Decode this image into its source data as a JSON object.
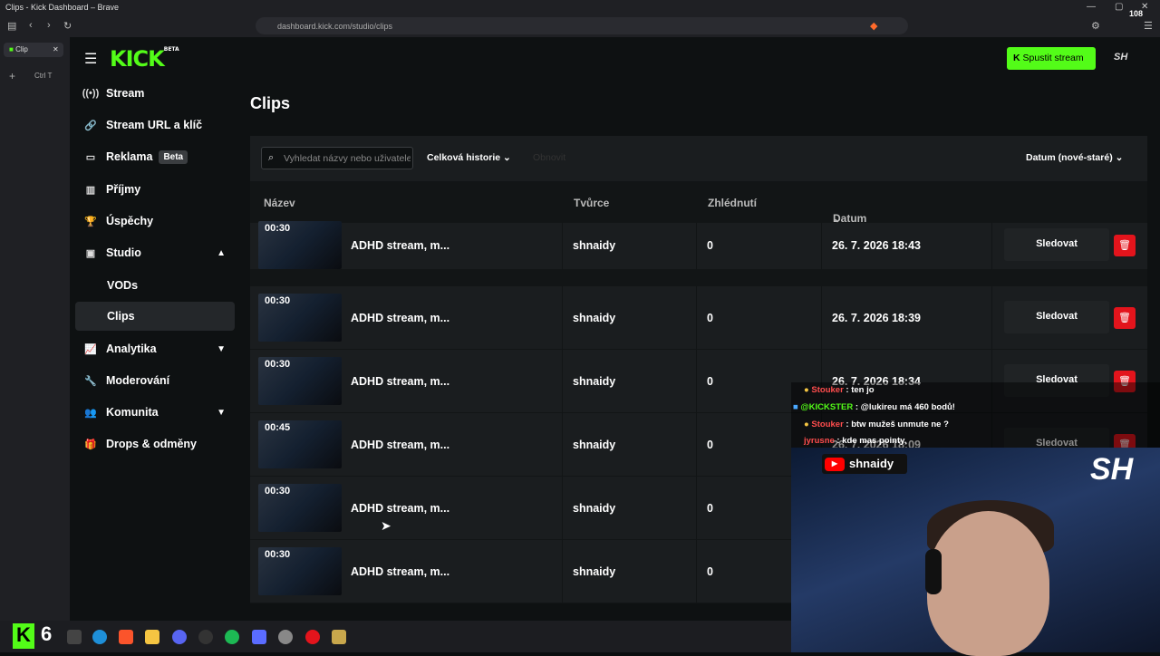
{
  "browser": {
    "window_title": "Clips - Kick Dashboard – Brave",
    "url": "dashboard.kick.com/studio/clips",
    "tab_label": "Clip",
    "tab_shortcut": "Ctrl T",
    "counter": "108"
  },
  "header": {
    "logo": "KICK",
    "logo_badge": "BETA",
    "go_live_label": "Spustit stream",
    "avatar_label": "SH"
  },
  "sidebar": {
    "items": [
      {
        "icon": "broadcast-icon",
        "label": "Stream"
      },
      {
        "icon": "link-icon",
        "label": "Stream URL a klíč"
      },
      {
        "icon": "ad-icon",
        "label": "Reklama",
        "badge": "Beta"
      },
      {
        "icon": "revenue-icon",
        "label": "Příjmy"
      },
      {
        "icon": "trophy-icon",
        "label": "Úspěchy"
      },
      {
        "icon": "studio-icon",
        "label": "Studio"
      },
      {
        "icon": "",
        "label": "VODs"
      },
      {
        "icon": "",
        "label": "Clips"
      },
      {
        "icon": "analytics-icon",
        "label": "Analytika"
      },
      {
        "icon": "wrench-icon",
        "label": "Moderování"
      },
      {
        "icon": "community-icon",
        "label": "Komunita"
      },
      {
        "icon": "drops-icon",
        "label": "Drops & odměny"
      }
    ]
  },
  "page": {
    "title": "Clips",
    "search_placeholder": "Vyhledat názvy nebo uživatele",
    "filter_label": "Celková historie",
    "dim_button": "Obnovit",
    "sort_label": "Datum (nové-staré)"
  },
  "table": {
    "columns": [
      "Název",
      "Tvůrce",
      "Zhlédnutí",
      "Datum"
    ],
    "watch_label": "Sledovat",
    "rows": [
      {
        "duration": "00:30",
        "title": "ADHD stream, m...",
        "creator": "shnaidy",
        "views": "0",
        "date": "26. 7. 2026 18:43"
      },
      {
        "duration": "00:30",
        "title": "ADHD stream, m...",
        "creator": "shnaidy",
        "views": "0",
        "date": "26. 7. 2026 18:39"
      },
      {
        "duration": "00:30",
        "title": "ADHD stream, m...",
        "creator": "shnaidy",
        "views": "0",
        "date": "26. 7. 2026 18:34"
      },
      {
        "duration": "00:45",
        "title": "ADHD stream, m...",
        "creator": "shnaidy",
        "views": "0",
        "date": "26. 7. 2026 18:09"
      },
      {
        "duration": "00:30",
        "title": "ADHD stream, m...",
        "creator": "shnaidy",
        "views": "0",
        "date": ""
      },
      {
        "duration": "00:30",
        "title": "ADHD stream, m...",
        "creator": "shnaidy",
        "views": "0",
        "date": ""
      }
    ]
  },
  "overlay": {
    "chat": [
      {
        "user": "Stouker",
        "sep": " : ",
        "text": "ten jo"
      },
      {
        "user": "@KICKSTER",
        "sep": " : ",
        "text": "@lukireu má 460 bodů!"
      },
      {
        "user": "Stouker",
        "sep": " : ",
        "text": "btw mužeš unmute ne ?"
      },
      {
        "user": "jyrusne",
        "sep": " : ",
        "text": "kde mas pointy,"
      }
    ],
    "channel_name": "shnaidy",
    "brand": "SH"
  },
  "taskbar": {
    "number": "6"
  },
  "colors": {
    "accent": "#53fc18",
    "danger": "#e3141c",
    "bg": "#0e1112",
    "panel": "#1a1d1f"
  }
}
